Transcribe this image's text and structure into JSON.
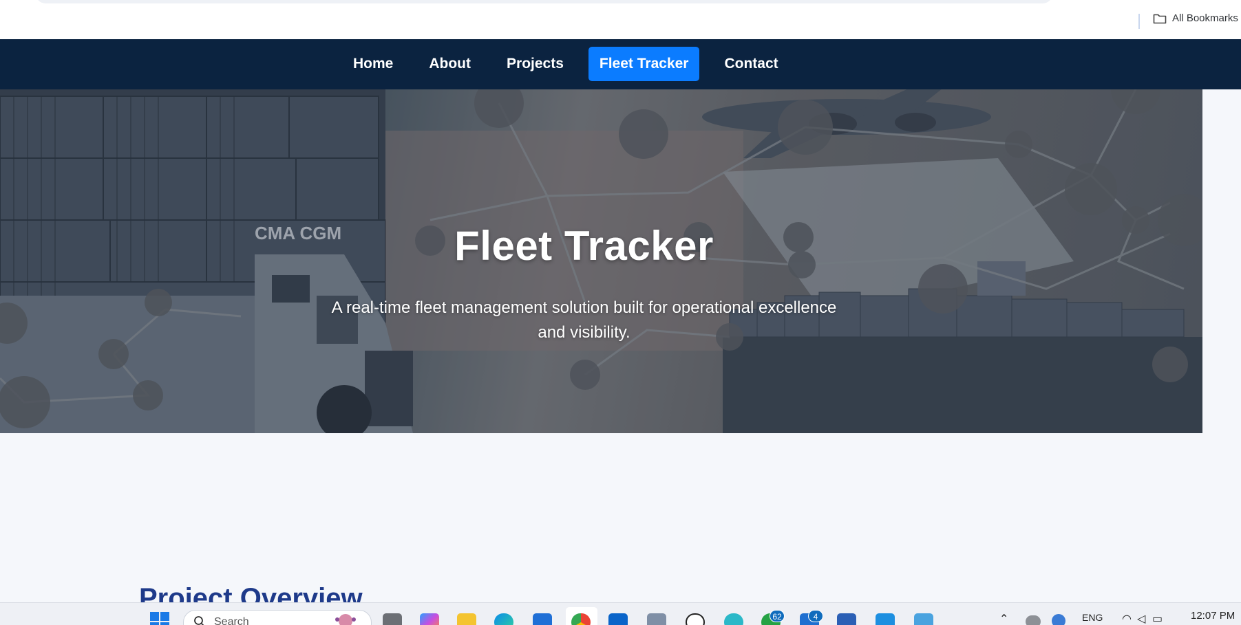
{
  "browser": {
    "bookmarks_label": "All Bookmarks",
    "folder_icon": "folder-icon"
  },
  "nav": {
    "items": [
      {
        "label": "Home",
        "active": false
      },
      {
        "label": "About",
        "active": false
      },
      {
        "label": "Projects",
        "active": false
      },
      {
        "label": "Fleet Tracker",
        "active": true
      },
      {
        "label": "Contact",
        "active": false
      }
    ],
    "background": "#0b2340",
    "active_color": "#0b7cff"
  },
  "hero": {
    "title": "Fleet Tracker",
    "subtitle": "A real-time fleet management solution built for operational excellence and visibility.",
    "image_logo_text": "CMA CGM"
  },
  "section": {
    "heading": "Project Overview",
    "heading_color": "#1e3a8a"
  },
  "taskbar": {
    "search_placeholder": "Search",
    "badges": {
      "whatsapp": "62",
      "outlook_teams": "4"
    },
    "language": "ENG",
    "time": "12:07 PM",
    "apps": [
      "start-icon",
      "search-icon",
      "task-view-icon",
      "copilot-icon",
      "file-explorer-icon",
      "edge-icon",
      "store-icon",
      "chrome-icon",
      "outlook-icon",
      "mail-icon",
      "chatgpt-icon",
      "app-icon",
      "whatsapp-icon",
      "teams-icon",
      "word-icon",
      "vscode-icon",
      "notepad-icon"
    ]
  }
}
